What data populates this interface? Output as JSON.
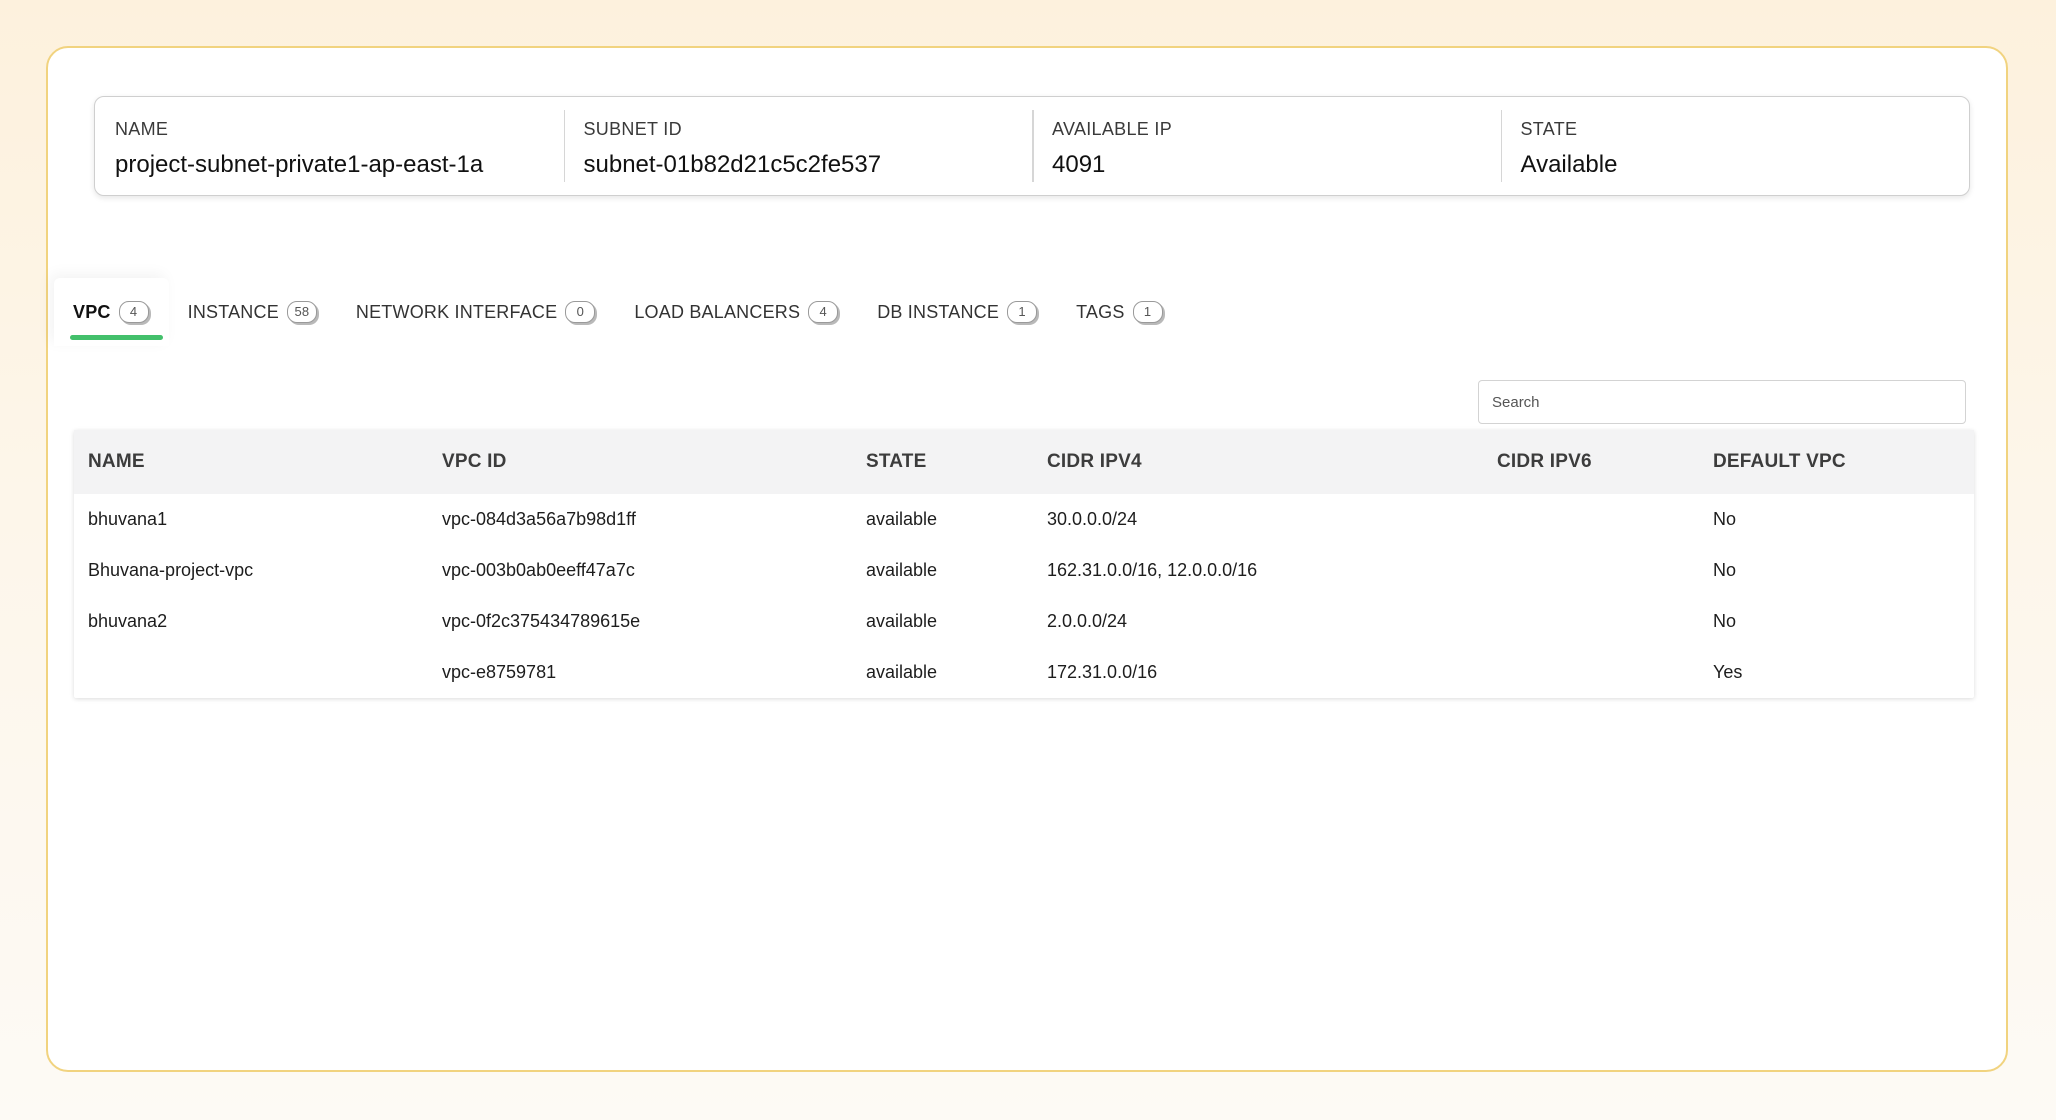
{
  "summary": [
    {
      "label": "NAME",
      "value": "project-subnet-private1-ap-east-1a"
    },
    {
      "label": "SUBNET ID",
      "value": "subnet-01b82d21c5c2fe537"
    },
    {
      "label": "AVAILABLE IP",
      "value": "4091"
    },
    {
      "label": "STATE",
      "value": "Available"
    }
  ],
  "tabs": [
    {
      "label": "VPC",
      "count": "4",
      "active": true
    },
    {
      "label": "INSTANCE",
      "count": "58"
    },
    {
      "label": "NETWORK INTERFACE",
      "count": "0"
    },
    {
      "label": "LOAD BALANCERS",
      "count": "4"
    },
    {
      "label": "DB INSTANCE",
      "count": "1"
    },
    {
      "label": "TAGS",
      "count": "1"
    }
  ],
  "search": {
    "placeholder": "Search"
  },
  "table": {
    "headers": [
      "NAME",
      "VPC ID",
      "STATE",
      "CIDR IPV4",
      "CIDR IPV6",
      "DEFAULT VPC"
    ],
    "rows": [
      [
        "bhuvana1",
        "vpc-084d3a56a7b98d1ff",
        "available",
        "30.0.0.0/24",
        "",
        "No"
      ],
      [
        "Bhuvana-project-vpc",
        "vpc-003b0ab0eeff47a7c",
        "available",
        "162.31.0.0/16, 12.0.0.0/16",
        "",
        "No"
      ],
      [
        "bhuvana2",
        "vpc-0f2c375434789615e",
        "available",
        "2.0.0.0/24",
        "",
        "No"
      ],
      [
        "",
        "vpc-e8759781",
        "available",
        "172.31.0.0/16",
        "",
        "Yes"
      ]
    ]
  },
  "colors": {
    "accent_underline": "#43c06b",
    "frame_border": "#f1d37f",
    "header_bg": "#f3f3f4"
  }
}
